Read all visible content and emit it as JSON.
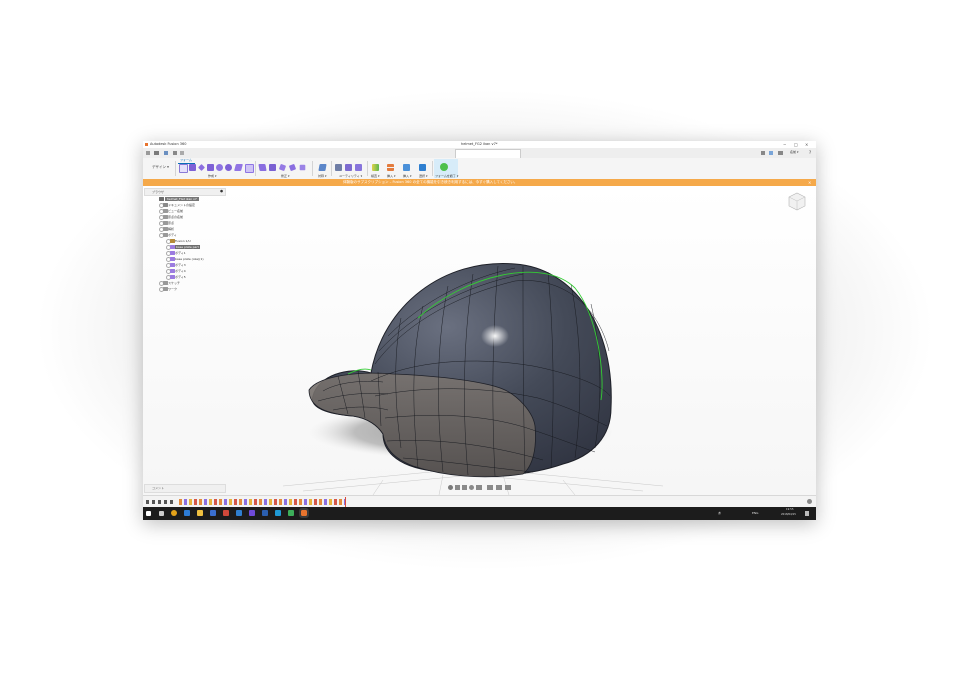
{
  "window": {
    "app_title": "Autodesk Fusion 360",
    "doc_title": "helmet_FG2 ikan v7*",
    "min": "−",
    "max": "□",
    "close": "×"
  },
  "tabs": {
    "user": "名前 ▾",
    "help": "?"
  },
  "toolbar": {
    "workspace": "デザイン ▾",
    "mode_tab": "フォーム",
    "groups": {
      "create": "作成 ▾",
      "modify": "修正 ▾",
      "symmetry": "対称 ▾",
      "utilities": "ユーティリティ ▾",
      "inspect": "検査 ▾",
      "insert": "挿入 ▾",
      "select": "選択 ▾",
      "finish": "フォームを終了 ▾"
    }
  },
  "banner": {
    "text": "体験版のサブスクリプション – Fusion 360 の全ての機能を引き続き利用するには、今すぐ購入してください。"
  },
  "browser": {
    "title": "ブラウザ",
    "items": [
      {
        "label": "helmet_FG2 ikan v7",
        "selected": true
      },
      {
        "label": "ドキュメントの設定"
      },
      {
        "label": "ビュー名前"
      },
      {
        "label": "原点の名前"
      },
      {
        "label": "原点"
      },
      {
        "label": "解析"
      },
      {
        "label": "ボディ"
      },
      {
        "label": "Fusion 1/U"
      },
      {
        "label": "base plate part",
        "selected": true
      },
      {
        "label": "ボディ1"
      },
      {
        "label": "base plate (oke)(1)"
      },
      {
        "label": "ボディ3"
      },
      {
        "label": "ボディ4"
      },
      {
        "label": "ボディ5"
      },
      {
        "label": "スケッチ"
      },
      {
        "label": "ワーク"
      }
    ]
  },
  "comments": {
    "label": "コメント"
  },
  "taskbar": {
    "time": "19:55",
    "date": "2018/04/15",
    "ime": "あ",
    "lang": "ENG"
  },
  "colors": {
    "banner": "#f5a94a",
    "helmet_shell": "#3f4452",
    "helmet_lower": "#6d6866",
    "symmetry_line": "#33cc33",
    "taskbar": "#1c1c1c"
  }
}
